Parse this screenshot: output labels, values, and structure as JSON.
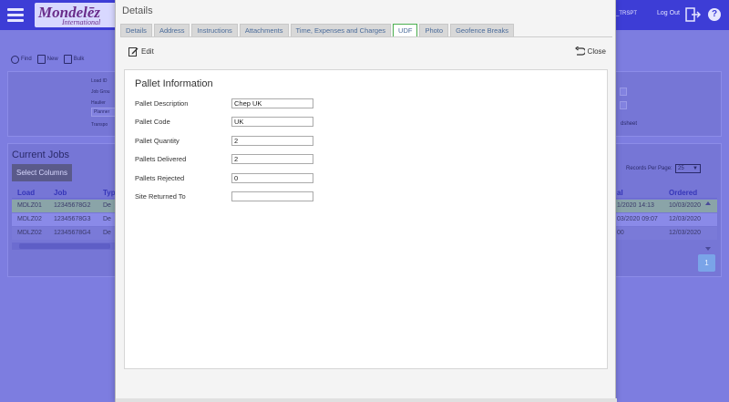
{
  "app": {
    "brand": "Mondelēz",
    "brand_sub": "International",
    "user": "_TRSPT",
    "logout": "Log Out",
    "help": "?"
  },
  "bg": {
    "actions": [
      "Find",
      "New",
      "Bulk"
    ],
    "fields": [
      "Load ID",
      "Job Grou",
      "Haulier",
      "Transpo"
    ],
    "planner_chip": "Planner",
    "sheet_label": "dsheet",
    "jobs_title": "Current Jobs",
    "select_columns": "Select Columns",
    "records_per_page_label": "Records Per Page:",
    "records_per_page_value": "25",
    "columns": {
      "load": "Load",
      "job": "Job",
      "type": "Typ",
      "arrival": "al",
      "ordered": "Ordered"
    },
    "rows": [
      {
        "load": "MDLZ01",
        "job": "12345678G2",
        "type": "De",
        "arrival": "1/2020 14:13",
        "ordered": "10/03/2020"
      },
      {
        "load": "MDLZ02",
        "job": "12345678G3",
        "type": "De",
        "arrival": "03/2020 09:07",
        "ordered": "12/03/2020"
      },
      {
        "load": "MDLZ02",
        "job": "12345678G4",
        "type": "De",
        "arrival": "00",
        "ordered": "12/03/2020"
      }
    ],
    "page": "1"
  },
  "modal": {
    "title": "Details",
    "tabs": [
      {
        "label": "Details"
      },
      {
        "label": "Address"
      },
      {
        "label": "Instructions"
      },
      {
        "label": "Attachments"
      },
      {
        "label": "Time, Expenses and Charges"
      },
      {
        "label": "UDF"
      },
      {
        "label": "Photo"
      },
      {
        "label": "Geofence Breaks"
      }
    ],
    "active_tab": "UDF",
    "edit_label": "Edit",
    "close_label": "Close",
    "section_title": "Pallet Information",
    "fields": [
      {
        "label": "Pallet Description",
        "value": "Chep UK"
      },
      {
        "label": "Pallet Code",
        "value": "UK"
      },
      {
        "label": "Pallet Quantity",
        "value": "2"
      },
      {
        "label": "Pallets Delivered",
        "value": "2"
      },
      {
        "label": "Pallets Rejected",
        "value": "0"
      },
      {
        "label": "Site Returned To",
        "value": ""
      }
    ]
  },
  "colors": {
    "overlay": "#7d7de0",
    "topbar": "#3d3dd6",
    "active_tab_border": "#4caf50",
    "tab_text": "#4a6b9a"
  }
}
